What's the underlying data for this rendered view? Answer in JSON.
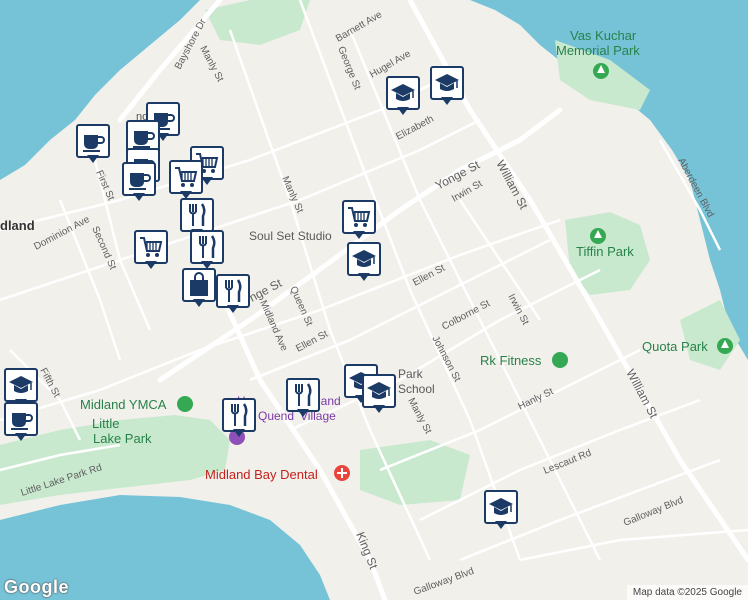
{
  "map": {
    "water_color": "#76c3d8",
    "land_color": "#f2f0eb",
    "park_color": "#c9e9cf",
    "road_color": "#ffffff",
    "marker_color": "#1b3a66"
  },
  "streets": {
    "bayshore": "Bayshore Dr",
    "manly_top": "Manly St",
    "barnett": "Barnett Ave",
    "george": "George St",
    "hugel": "Hugel Ave",
    "elizabeth": "Elizabeth",
    "yonge": "Yonge St",
    "william": "William St",
    "aberdeen": "Aberdeen Blvd",
    "irwin_top": "Irwin St",
    "first": "First St",
    "dominion": "Dominion Ave",
    "second": "Second St",
    "manly_mid": "Manly St",
    "yonge_left": "nge St",
    "queen": "Queen St",
    "midland_ave": "Midland Ave",
    "ellen_right": "Ellen St",
    "ellen_left": "Ellen St",
    "colborne": "Colborne St",
    "irwin_mid": "Irwin St",
    "johnson": "Johnson St",
    "fifth": "Fifth St",
    "hanly": "Hanly St",
    "manly_bottom": "Manly St",
    "little_lake_park_rd": "Little Lake Park Rd",
    "lescaut": "Lescaut Rd",
    "galloway_top": "Galloway Blvd",
    "galloway_bottom": "Galloway Blvd",
    "king": "King St",
    "william_bottom": "William St",
    "land_partial": "nd"
  },
  "places": {
    "vas_kuchar_1": "Vas Kuchar",
    "vas_kuchar_2": "Memorial Park",
    "tiffin_park": "Tiffin Park",
    "quota_park": "Quota Park",
    "rk_fitness": "Rk Fitness",
    "soul_set": "Soul Set Studio",
    "midland_ymca": "Midland YMCA",
    "little_lake_1": "Little",
    "little_lake_2": "Lake Park",
    "midland_bay_dental": "Midland Bay Dental",
    "town_partial": "dland",
    "park_school_1": "Park",
    "park_school_2": "School",
    "huronia_1": "H",
    "huronia_1b": "land",
    "huronia_2": "H",
    "huronia_2b": "Village",
    "quendat": "Quend"
  },
  "markers": [
    {
      "icon": "coffee-icon"
    },
    {
      "icon": "coffee-icon"
    },
    {
      "icon": "coffee-icon"
    },
    {
      "icon": "coffee-icon"
    },
    {
      "icon": "coffee-icon"
    },
    {
      "icon": "shopping-cart-icon"
    },
    {
      "icon": "shopping-cart-icon"
    },
    {
      "icon": "shopping-cart-icon"
    },
    {
      "icon": "shopping-cart-icon"
    },
    {
      "icon": "utensils-icon"
    },
    {
      "icon": "utensils-icon"
    },
    {
      "icon": "utensils-icon"
    },
    {
      "icon": "utensils-icon"
    },
    {
      "icon": "utensils-icon"
    },
    {
      "icon": "shopping-bag-icon"
    },
    {
      "icon": "school-icon"
    },
    {
      "icon": "school-icon"
    },
    {
      "icon": "school-icon"
    },
    {
      "icon": "school-icon"
    },
    {
      "icon": "school-icon"
    },
    {
      "icon": "school-icon"
    },
    {
      "icon": "school-icon"
    },
    {
      "icon": "coffee-icon"
    }
  ],
  "footer": {
    "logo": "Google",
    "attribution": "Map data ©2025 Google"
  }
}
